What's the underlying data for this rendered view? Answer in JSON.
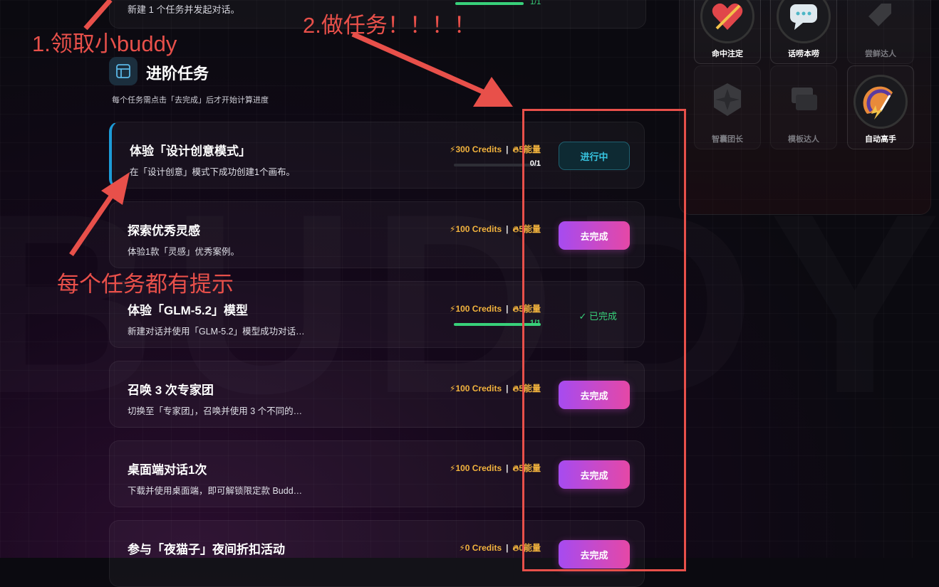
{
  "watermark": "BUDDY",
  "top_card": {
    "description": "新建 1 个任务并发起对话。",
    "progress_text": "1/1",
    "progress": 1
  },
  "section": {
    "icon": "layout-icon",
    "title": "进阶任务",
    "subtitle": "每个任务需点击「去完成」后才开始计算进度"
  },
  "tasks": [
    {
      "title": "体验「设计创意模式」",
      "desc": "在「设计创意」模式下成功创建1个画布。",
      "credits": "300 Credits",
      "energy": "5能量",
      "progress_text": "0/1",
      "progress": 0,
      "status": "进行中"
    },
    {
      "title": "探索优秀灵感",
      "desc": "体验1款「灵感」优秀案例。",
      "credits": "100 Credits",
      "energy": "5能量",
      "status": "去完成"
    },
    {
      "title": "体验「GLM-5.2」模型",
      "desc": "新建对话并使用「GLM-5.2」模型成功对话…",
      "credits": "100 Credits",
      "energy": "5能量",
      "progress_text": "1/1",
      "progress": 1,
      "status": "已完成"
    },
    {
      "title": "召唤 3 次专家团",
      "desc": "切换至「专家团」，召唤并使用 3 个不同的…",
      "credits": "100 Credits",
      "energy": "5能量",
      "status": "去完成"
    },
    {
      "title": "桌面端对话1次",
      "desc": "下载并使用桌面端，即可解锁限定款 Budd…",
      "credits": "100 Credits",
      "energy": "5能量",
      "status": "去完成"
    },
    {
      "title": "参与「夜猫子」夜间折扣活动",
      "desc": "",
      "credits": "0 Credits",
      "energy": "0能量",
      "status": "去完成"
    }
  ],
  "badges": [
    {
      "label": "命中注定",
      "icon": "heart-arrow-icon",
      "unlocked": true
    },
    {
      "label": "话唠本唠",
      "icon": "chat-bubble-icon",
      "unlocked": true
    },
    {
      "label": "尝鲜达人",
      "icon": "tag-icon",
      "unlocked": false
    },
    {
      "label": "智囊团长",
      "icon": "star-shield-icon",
      "unlocked": false
    },
    {
      "label": "模板达人",
      "icon": "template-icon",
      "unlocked": false
    },
    {
      "label": "自动高手",
      "icon": "speedometer-icon",
      "unlocked": true
    }
  ],
  "annotations": {
    "step1": "1.领取小buddy",
    "step2": "2.做任务！！！！",
    "hint": "每个任务都有提示"
  },
  "colors": {
    "accent_gradient_start": "#a64bf0",
    "accent_gradient_end": "#e548a6",
    "progress_green": "#38d17a",
    "in_progress_cyan": "#37c4e0",
    "credit_gold": "#f2b33d",
    "annotation_red": "#e8504a"
  }
}
